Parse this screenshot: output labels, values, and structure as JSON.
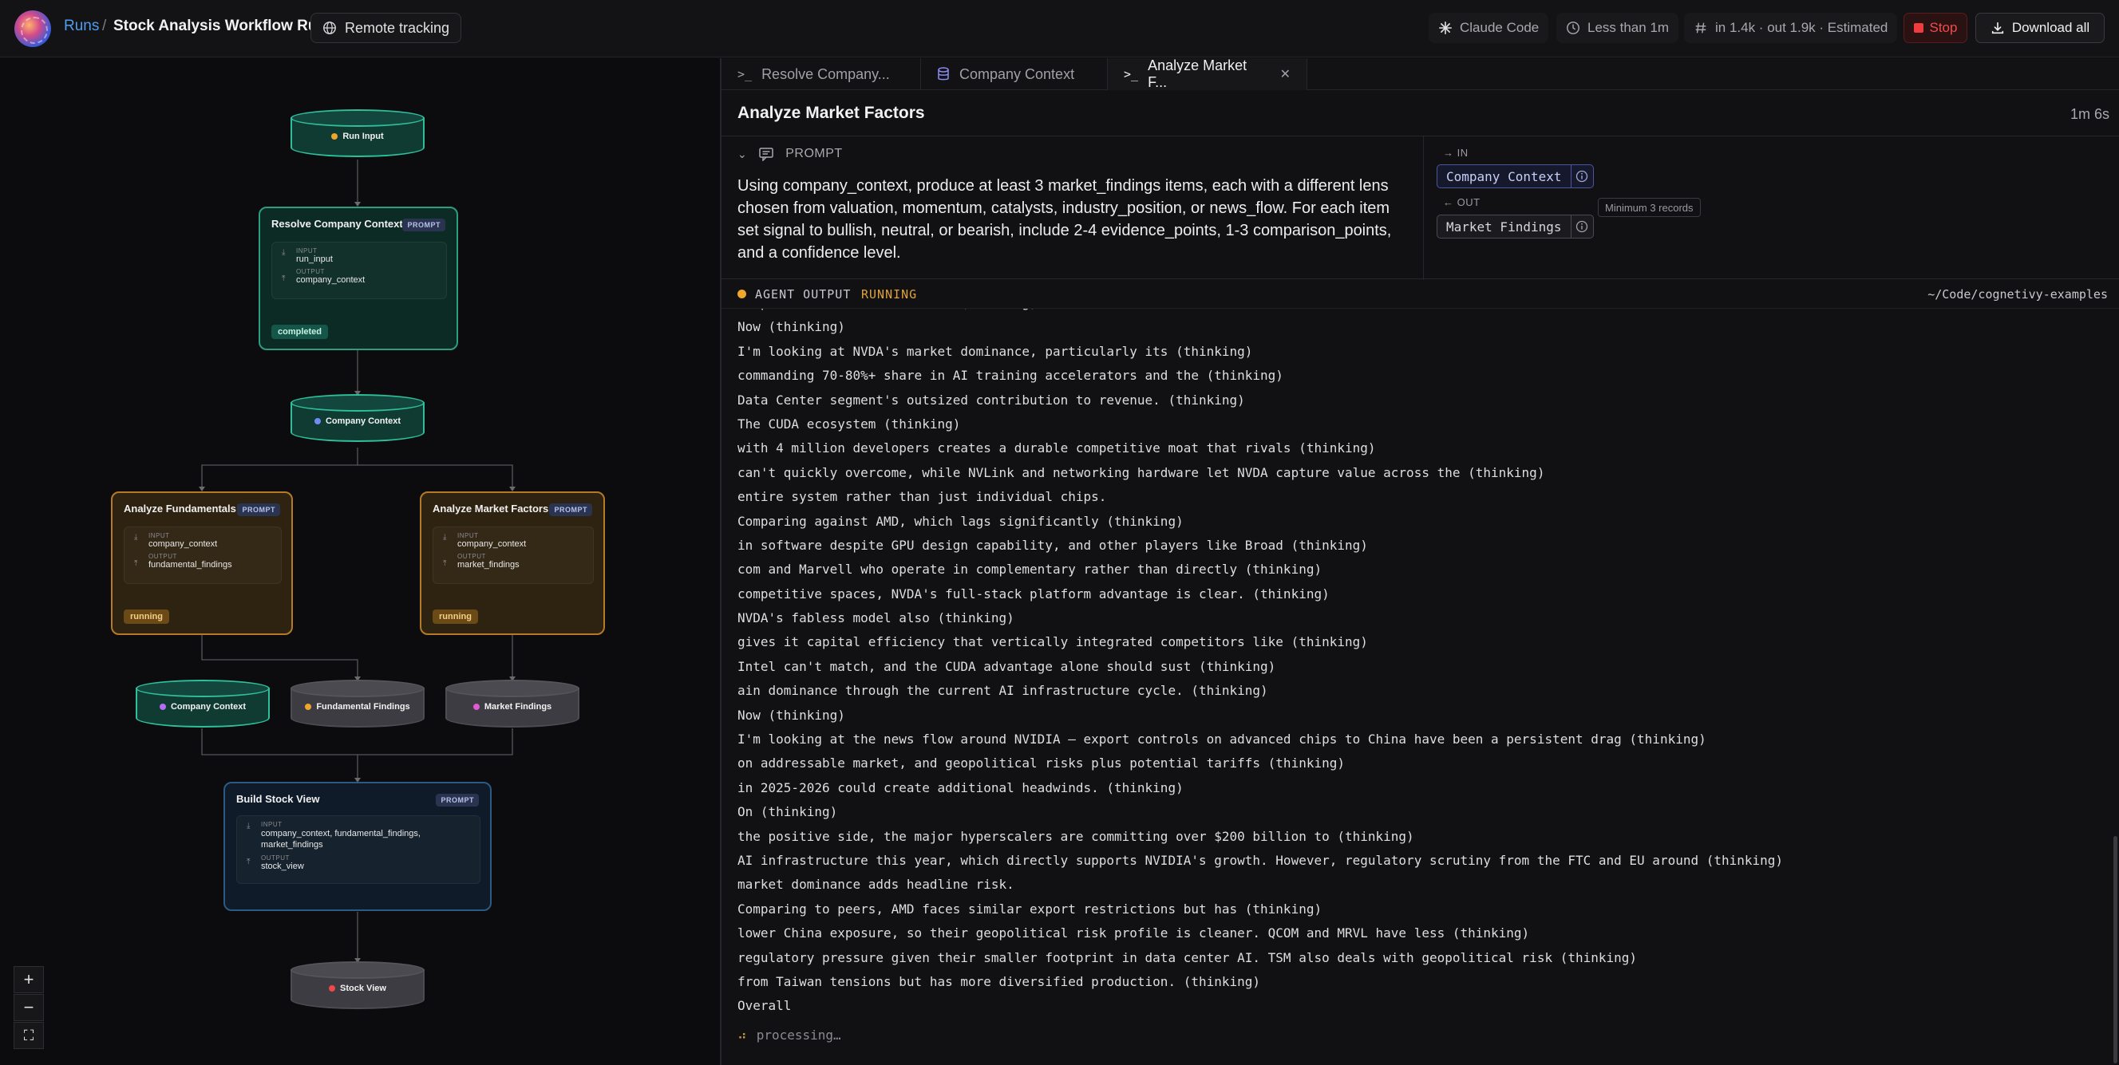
{
  "header": {
    "breadcrumb_link": "Runs",
    "breadcrumb_sep": "/",
    "title": "Stock Analysis Workflow Run",
    "remote_tracking": "Remote tracking",
    "agent": "Claude Code",
    "duration": "Less than 1m",
    "tokens": "in 1.4k · out 1.9k · Estimated",
    "stop": "Stop",
    "download": "Download all"
  },
  "graph": {
    "nodes": {
      "run_input": "Run Input",
      "resolve": {
        "title": "Resolve Company Context",
        "badge": "PROMPT",
        "input_label": "INPUT",
        "input": "run_input",
        "output_label": "OUTPUT",
        "output": "company_context",
        "status": "completed"
      },
      "company_context": "Company Context",
      "fundamentals": {
        "title": "Analyze Fundamentals",
        "badge": "PROMPT",
        "input_label": "INPUT",
        "input": "company_context",
        "output_label": "OUTPUT",
        "output": "fundamental_findings",
        "status": "running"
      },
      "market": {
        "title": "Analyze Market Factors",
        "badge": "PROMPT",
        "input_label": "INPUT",
        "input": "company_context",
        "output_label": "OUTPUT",
        "output": "market_findings",
        "status": "running"
      },
      "company_context_2": "Company Context",
      "fundamental_findings": "Fundamental Findings",
      "market_findings": "Market Findings",
      "build": {
        "title": "Build Stock View",
        "badge": "PROMPT",
        "input_label": "INPUT",
        "input": "company_context, fundamental_findings, market_findings",
        "output_label": "OUTPUT",
        "output": "stock_view"
      },
      "stock_view": "Stock View"
    },
    "colors": {
      "dot_orange": "#f0a52b",
      "dot_blue": "#6e8cf5",
      "dot_purple": "#b66cf0",
      "dot_pink": "#e05ad0",
      "dot_red": "#f04848"
    },
    "zoom_in": "+",
    "zoom_out": "−",
    "fit": "⛶"
  },
  "tabs": [
    {
      "label": "Resolve Company...",
      "icon": "terminal-icon"
    },
    {
      "label": "Company Context",
      "icon": "database-icon"
    },
    {
      "label": "Analyze Market F...",
      "icon": "terminal-icon"
    }
  ],
  "step": {
    "title": "Analyze Market Factors",
    "duration": "1m 6s",
    "prompt_label": "PROMPT",
    "prompt": "Using company_context, produce at least 3 market_findings items, each with a different lens chosen from valuation, momentum, catalysts, industry_position, or news_flow. For each item set signal to bullish, neutral, or bearish, include 2-4 evidence_points, 1-3 comparison_points, and a confidence level.",
    "in_label": "IN",
    "in_chip": "Company Context",
    "out_label": "OUT",
    "out_chip": "Market Findings",
    "out_note": "Minimum 3 records"
  },
  "output": {
    "label": "AGENT OUTPUT",
    "status": "RUNNING",
    "path": "~/Code/cognetivy-examples",
    "lines": [
      "competitors haven't cracked. (thinking)",
      "Now (thinking)",
      "I'm looking at NVDA's market dominance, particularly its (thinking)",
      "commanding 70-80%+ share in AI training accelerators and the (thinking)",
      "Data Center segment's outsized contribution to revenue. (thinking)",
      "The CUDA ecosystem (thinking)",
      "with 4 million developers creates a durable competitive moat that rivals (thinking)",
      "can't quickly overcome, while NVLink and networking hardware let NVDA capture value across the (thinking)",
      "entire system rather than just individual chips.",
      "Comparing against AMD, which lags significantly (thinking)",
      "in software despite GPU design capability, and other players like Broad (thinking)",
      "com and Marvell who operate in complementary rather than directly (thinking)",
      "competitive spaces, NVDA's full-stack platform advantage is clear. (thinking)",
      "NVDA's fabless model also (thinking)",
      "gives it capital efficiency that vertically integrated competitors like (thinking)",
      "Intel can't match, and the CUDA advantage alone should sust (thinking)",
      "ain dominance through the current AI infrastructure cycle. (thinking)",
      "Now (thinking)",
      "I'm looking at the news flow around NVIDIA — export controls on advanced chips to China have been a persistent drag (thinking)",
      "on addressable market, and geopolitical risks plus potential tariffs (thinking)",
      "in 2025-2026 could create additional headwinds. (thinking)",
      "On (thinking)",
      "the positive side, the major hyperscalers are committing over $200 billion to (thinking)",
      "AI infrastructure this year, which directly supports NVIDIA's growth. However, regulatory scrutiny from the FTC and EU around (thinking)",
      "market dominance adds headline risk.",
      "Comparing to peers, AMD faces similar export restrictions but has (thinking)",
      "lower China exposure, so their geopolitical risk profile is cleaner. QCOM and MRVL have less (thinking)",
      "regulatory pressure given their smaller footprint in data center AI. TSM also deals with geopolitical risk (thinking)",
      "from Taiwan tensions but has more diversified production. (thinking)",
      "Overall"
    ],
    "processing": "processing…"
  }
}
